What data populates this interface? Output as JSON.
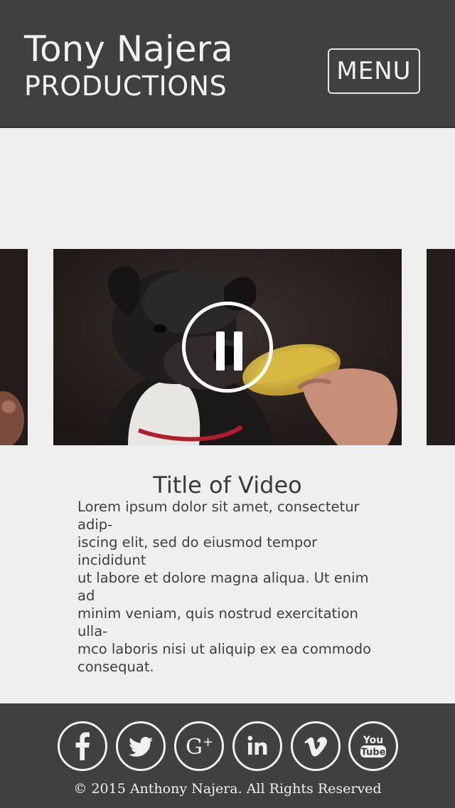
{
  "header": {
    "brand_name": "Tony Najera",
    "brand_sub": "PRODUCTIONS",
    "menu_label": "MENU"
  },
  "video": {
    "title": "Title of Video",
    "description": "Lorem ipsum dolor sit amet, consectetur adip-\niscing elit, sed do eiusmod tempor incididunt\nut labore et dolore magna aliqua. Ut enim ad\nminim veniam, quis nostrud exercitation ulla-\nmco laboris nisi ut aliquip ex ea commodo\nconsequat.",
    "state": "playing"
  },
  "footer": {
    "social": [
      {
        "name": "facebook-icon"
      },
      {
        "name": "twitter-icon"
      },
      {
        "name": "google-plus-icon"
      },
      {
        "name": "linkedin-icon"
      },
      {
        "name": "vimeo-icon"
      },
      {
        "name": "youtube-icon",
        "label_top": "You",
        "label_bottom": "Tube"
      }
    ],
    "copyright": "© 2015 Anthony Najera. All Rights Reserved"
  },
  "colors": {
    "header_bg": "#404040",
    "page_bg": "#efefef",
    "text_light": "#f2f2f2",
    "text_dark": "#3a3a3a"
  }
}
